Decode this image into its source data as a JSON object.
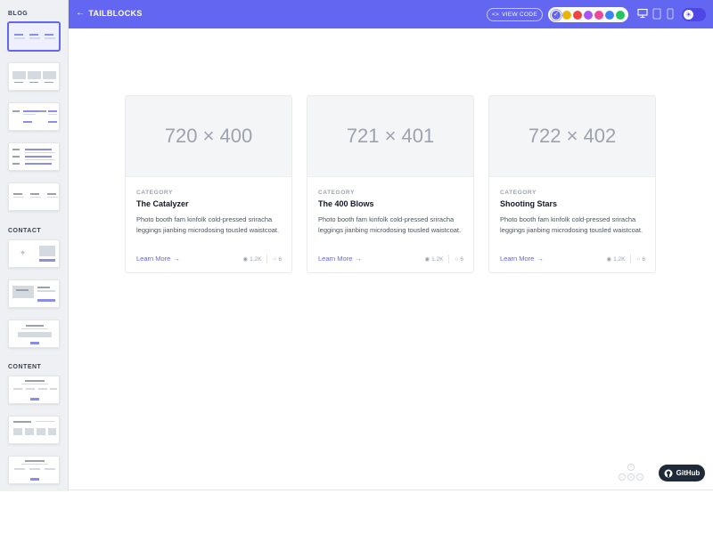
{
  "sidebar": {
    "sections": [
      "BLOG",
      "CONTACT",
      "CONTENT"
    ]
  },
  "header": {
    "back_label": "TAILBLOCKS",
    "view_code_label": "VIEW CODE",
    "colors": [
      "#6366f1",
      "#eab308",
      "#ef4444",
      "#a855f7",
      "#ec4899",
      "#3b82f6",
      "#22c55e"
    ],
    "selected_color": "#6366f1",
    "accent": "#6366f1"
  },
  "cards": [
    {
      "image_label": "720 × 400",
      "category": "CATEGORY",
      "title": "The Catalyzer",
      "description": "Photo booth fam kinfolk cold-pressed sriracha leggings jianbing microdosing tousled waistcoat.",
      "link": "Learn More",
      "views": "1.2K",
      "comments": "6"
    },
    {
      "image_label": "721 × 401",
      "category": "CATEGORY",
      "title": "The 400 Blows",
      "description": "Photo booth fam kinfolk cold-pressed sriracha leggings jianbing microdosing tousled waistcoat.",
      "link": "Learn More",
      "views": "1.2K",
      "comments": "6"
    },
    {
      "image_label": "722 × 402",
      "category": "CATEGORY",
      "title": "Shooting Stars",
      "description": "Photo booth fam kinfolk cold-pressed sriracha leggings jianbing microdosing tousled waistcoat.",
      "link": "Learn More",
      "views": "1.2K",
      "comments": "6"
    }
  ],
  "github_label": "GitHub"
}
